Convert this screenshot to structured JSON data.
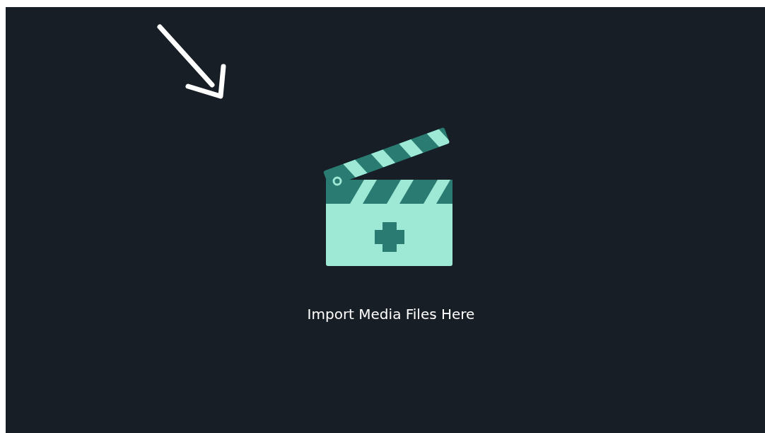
{
  "drop_area": {
    "label": "Import Media Files Here"
  }
}
